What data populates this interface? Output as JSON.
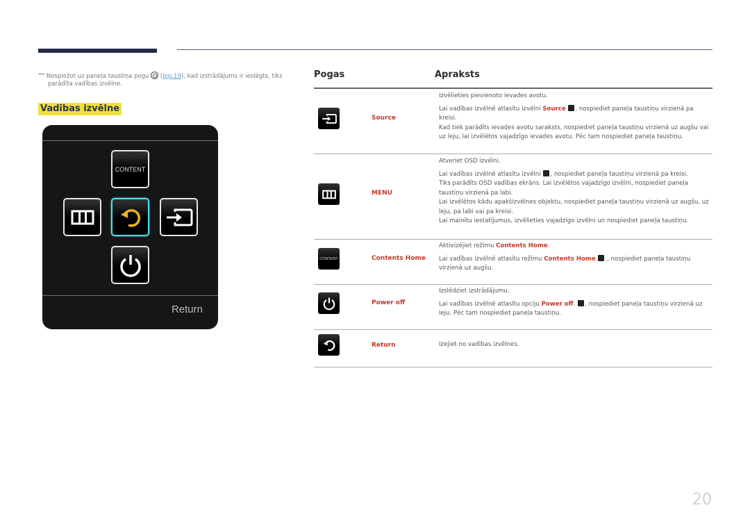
{
  "note": {
    "part1": "Nospiežot uz paneļa taustiņa pogu",
    "link": "lpp.19",
    "part2": ", kad izstrādājums ir ieslēgts, tiks",
    "part3": "parādīta vadības izvēlne.",
    "open_paren": "(",
    "close_paren": ")"
  },
  "section_title": "Vadības izvēlne",
  "remote": {
    "content_label": "CONTENT",
    "return_label": "Return"
  },
  "table": {
    "header_buttons": "Pogas",
    "header_description": "Apraksts",
    "rows": [
      {
        "name": "Source",
        "lines": [
          "Izvēlieties pievienoto ievades avotu.",
          "Lai vadības izvēlnē atlasītu izvēlni ",
          "Source",
          ", nospiediet paneļa taustiņu virzienā pa kreisi.",
          "Kad tiek parādīts ievades avotu saraksts, nospiediet paneļa taustiņu virzienā uz augšu vai uz leju, lai izvēlētos vajadzīgo ievades avotu. Pēc tam nospiediet paneļa taustiņu."
        ]
      },
      {
        "name": "MENU",
        "lines": [
          "Atveriet OSD izvēlni.",
          "Lai vadības izvēlnē atlasītu izvēlni ",
          ", nospiediet paneļa taustiņu virzienā pa kreisi.",
          "Tiks parādīts OSD vadības ekrāns. Lai izvēlētos vajadzīgo izvēlni, nospiediet paneļa taustiņu virzienā pa labi.",
          "Lai izvēlētos kādu apakšizvēlnes objektu, nospiediet paneļa taustiņu virzienā uz augšu, uz leju, pa labi vai pa kreisi.",
          "Lai mainītu iestatījumus, izvēlieties vajadzīgo izvēlni un nospiediet paneļa taustiņu."
        ]
      },
      {
        "name": "Contents Home",
        "tile_label": "CONTENT",
        "lines": [
          "Aktivizējiet režīmu ",
          "Contents Home",
          ".",
          "Lai vadības izvēlnē atlasītu režīmu ",
          "Contents Home",
          " , nospiediet paneļa taustiņu virzienā uz augšu."
        ]
      },
      {
        "name": "Power off",
        "lines": [
          "Izslēdziet izstrādājumu.",
          "Lai vadības izvēlnē atlasītu opciju ",
          "Power off",
          ", nospiediet paneļa taustiņu virzienā uz leju. Pēc tam nospiediet paneļa taustiņu."
        ]
      },
      {
        "name": "Return",
        "lines": [
          "Izejiet no vadības izvēlnes."
        ]
      }
    ]
  },
  "page_number": "20",
  "colors": {
    "accent_red": "#c0392b",
    "highlight_yellow": "#f0e03c",
    "navy": "#252a48",
    "selection_cyan": "#5ad8e6",
    "return_icon_yellow": "#f2b41c"
  }
}
